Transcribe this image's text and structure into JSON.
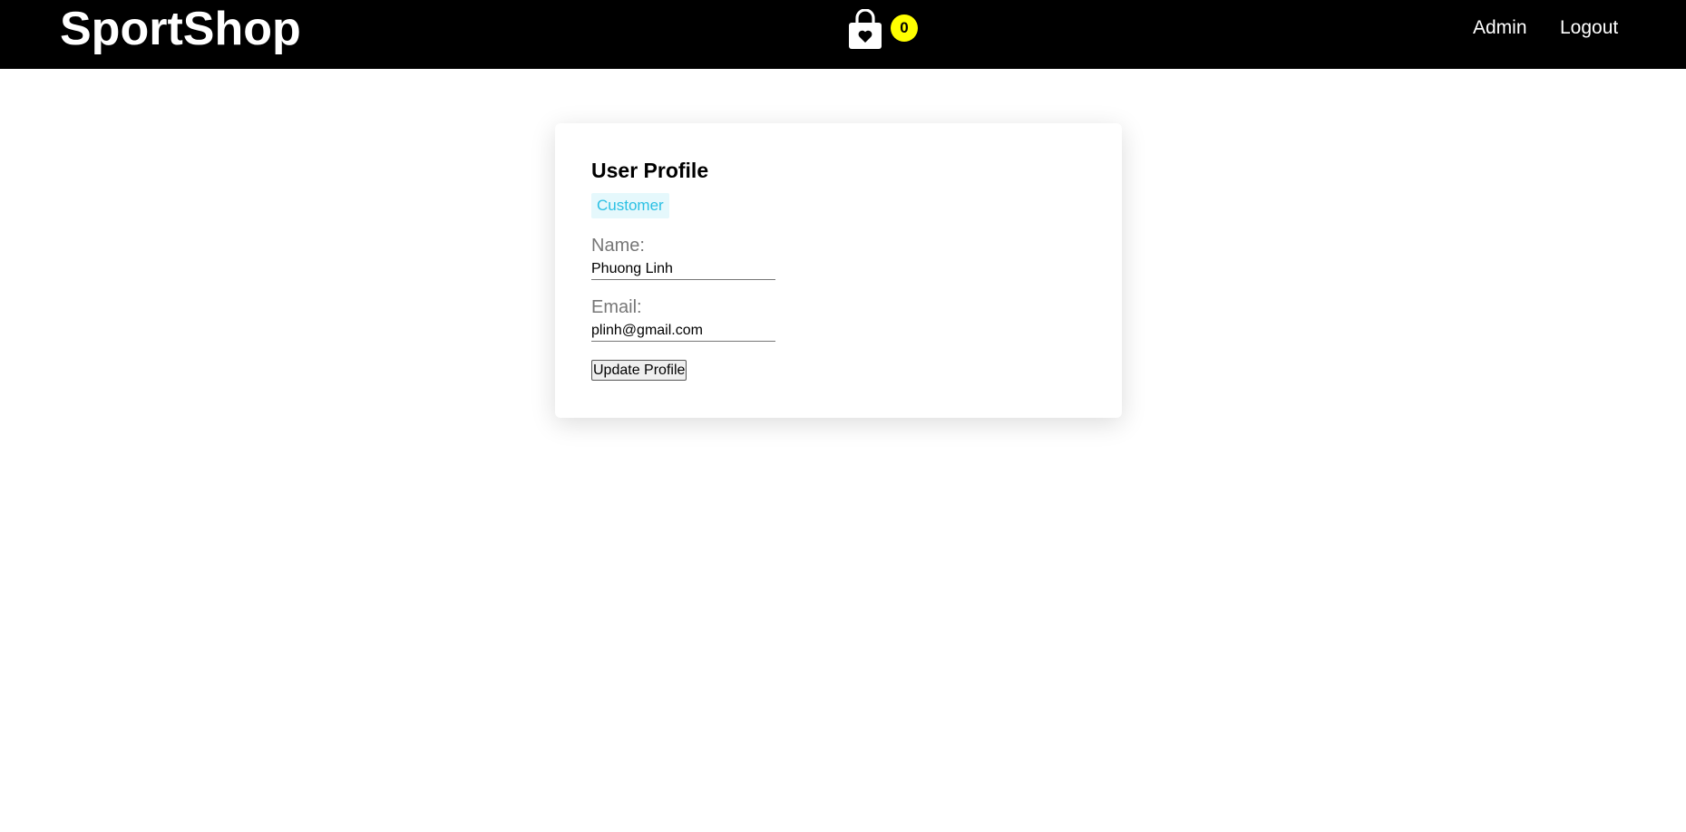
{
  "navbar": {
    "brand": "SportShop",
    "cart_icon": "shopping-bag-heart-icon",
    "cart_count": "0",
    "links": {
      "admin": "Admin",
      "logout": "Logout"
    }
  },
  "profile": {
    "title": "User Profile",
    "role": "Customer",
    "name_label": "Name:",
    "name_value": "Phuong Linh",
    "email_label": "Email:",
    "email_value": "plinh@gmail.com",
    "update_button": "Update Profile"
  },
  "colors": {
    "navbar_bg": "#000000",
    "badge_bg": "#ffff00",
    "role_text": "#2bc0e4",
    "role_bg": "#e5f8fc"
  }
}
